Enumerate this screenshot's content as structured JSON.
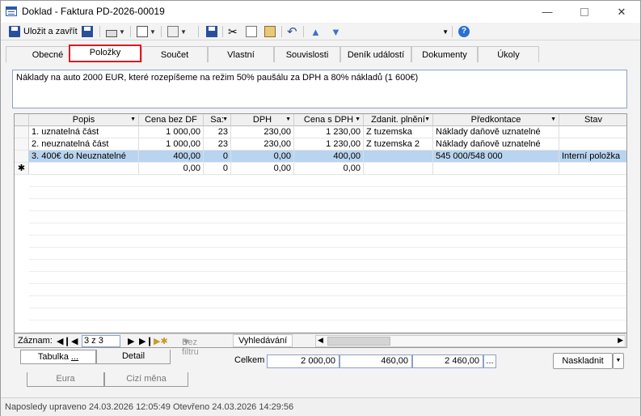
{
  "window": {
    "title": "Doklad - Faktura PD-2026-00019"
  },
  "toolbar": {
    "save_close_label": "Uložit a zavřít",
    "search_value": ""
  },
  "tabs": [
    {
      "label": "Obecné"
    },
    {
      "label": "Položky"
    },
    {
      "label": "Součet"
    },
    {
      "label": "Vlastní"
    },
    {
      "label": "Souvislosti"
    },
    {
      "label": "Deník událostí"
    },
    {
      "label": "Dokumenty"
    },
    {
      "label": "Úkoly"
    }
  ],
  "note": "Náklady na auto 2000 EUR, které rozepíšeme na režim 50% paušálu za DPH a 80% nákladů (1 600€)",
  "grid": {
    "columns": [
      "Popis",
      "Cena bez DF",
      "Sa:",
      "DPH",
      "Cena s DPH",
      "Zdanit. plnění",
      "Předkontace",
      "Stav"
    ],
    "rows": [
      {
        "popis": "1. uznatelná část",
        "cena_bez": "1 000,00",
        "sazba": "23",
        "dph": "230,00",
        "cena_s": "1 230,00",
        "zdanit": "Z tuzemska",
        "predkontace": "Náklady daňově uznatelné",
        "stav": ""
      },
      {
        "popis": "2. neuznatelná část",
        "cena_bez": "1 000,00",
        "sazba": "23",
        "dph": "230,00",
        "cena_s": "1 230,00",
        "zdanit": "Z tuzemska 2",
        "predkontace": "Náklady daňově uznatelné",
        "stav": ""
      },
      {
        "popis": "3. 400€ do Neuznatelné",
        "cena_bez": "400,00",
        "sazba": "0",
        "dph": "0,00",
        "cena_s": "400,00",
        "zdanit": "",
        "predkontace": "545 000/548 000",
        "stav": "Interní položka"
      },
      {
        "popis": "",
        "cena_bez": "0,00",
        "sazba": "0",
        "dph": "0,00",
        "cena_s": "0,00",
        "zdanit": "",
        "predkontace": "",
        "stav": ""
      }
    ],
    "new_row_marker": "✱"
  },
  "navigator": {
    "record_label": "Záznam:",
    "record_value": "3 z 3",
    "filter_label": "Bez filtru",
    "search_label": "Vyhledávání"
  },
  "subtabs": {
    "table": "Tabulka",
    "table_ellipsis": "...",
    "detail": "Detail",
    "euro": "Eura",
    "foreign": "Cizí měna"
  },
  "totals": {
    "label": "Celkem",
    "bez": "2 000,00",
    "dph": "460,00",
    "s": "2 460,00",
    "ellipsis": "..."
  },
  "buttons": {
    "naskladnit": "Naskladnit"
  },
  "status": "Naposledy upraveno 24.03.2026 12:05:49 Otevřeno 24.03.2026 14:29:56"
}
